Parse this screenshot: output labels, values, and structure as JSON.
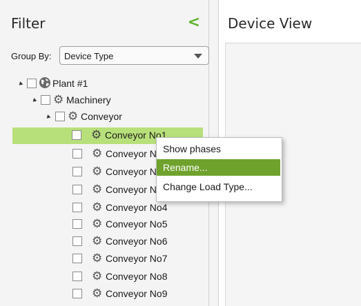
{
  "filter": {
    "title": "Filter",
    "collapse_glyph": "<",
    "group_by_label": "Group By:",
    "group_by_value": "Device Type"
  },
  "device_view": {
    "title": "Device View"
  },
  "tree": [
    {
      "label": "Plant #1",
      "icon": "globe-icon"
    },
    {
      "label": "Machinery",
      "icon": "gear-icon"
    },
    {
      "label": "Conveyor",
      "icon": "gear-icon"
    },
    {
      "label": "Conveyor No1",
      "icon": "gear-icon"
    },
    {
      "label": "Conveyor No2",
      "icon": "gear-icon"
    },
    {
      "label": "Conveyor No3",
      "icon": "gear-icon"
    },
    {
      "label": "Conveyor No3",
      "icon": "gear-icon"
    },
    {
      "label": "Conveyor No4",
      "icon": "gear-icon"
    },
    {
      "label": "Conveyor No5",
      "icon": "gear-icon"
    },
    {
      "label": "Conveyor No6",
      "icon": "gear-icon"
    },
    {
      "label": "Conveyor No7",
      "icon": "gear-icon"
    },
    {
      "label": "Conveyor No8",
      "icon": "gear-icon"
    },
    {
      "label": "Conveyor No9",
      "icon": "gear-icon"
    }
  ],
  "context_menu": [
    {
      "label": "Show phases"
    },
    {
      "label": "Rename..."
    },
    {
      "label": "Change Load Type..."
    }
  ],
  "colors": {
    "accent": "#6fa22d",
    "selection": "#b8e07a",
    "collapse": "#5fb22b"
  }
}
